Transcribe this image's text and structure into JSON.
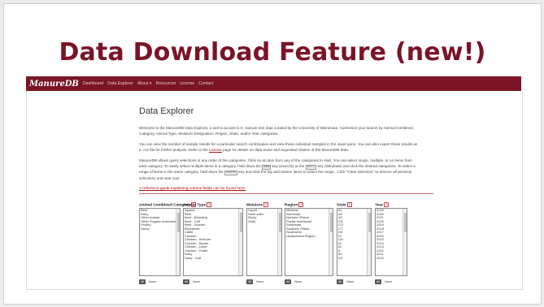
{
  "slide": {
    "title": "Data Download Feature (new!)"
  },
  "nav": {
    "brand": "ManureDB",
    "links": [
      "Dashboard",
      "Data Explorer",
      "About ▾",
      "Resources",
      "License",
      "Contact"
    ]
  },
  "page": {
    "heading": "Data Explorer",
    "para1": "Welcome to the ManureDB Data Explorer, a tool to access U.S. manure test data curated by the University of Minnesota. Customize your search by Animal Combined Category, Animal Type, Moisture Designation, Region, State, and/or Year categories.",
    "para2a": "You can view the number of sample results for a particular search combination and view those individual samples in the lower pane. You can also export those results as a .csv file for further analysis. Refer to the ",
    "para2_link": "License",
    "para2b": " page for details on data reuse and requested citation of the ManureDB data.",
    "para3a": "ManureDB allows query selections in any order of the categories. Click on an item from any of the categories to start. You can select single, multiple, or no items from each category. To easily select multiple items in a category, hold down the ",
    "key_cmd": "cmd",
    "para3b": " key (macOS) or the ",
    "key_ctrl": "ctrl",
    "para3c": " key (Windows) and click the desired categories. To select a range of items in the same category, hold down the ",
    "key_shift": "shift",
    "para3d": " key and click the top and bottom items to select the range.. Click \"Clear Selection\" to remove all previous selections and start over.",
    "reference_link": "A reference guide explaining column fields can be found here.",
    "buttons": {
      "all": "All",
      "none": "None"
    }
  },
  "filters": [
    {
      "label": "Animal Combined Category",
      "items": [
        "Beef",
        "Dairy",
        "Other Animal",
        "Other Organic Amendment",
        "Poultry",
        "Swine"
      ]
    },
    {
      "label": "Animal Type",
      "items": [
        "Alpaca",
        "Beef",
        "Beef - Breeding",
        "Beef - Calf",
        "Beef - Stocker",
        "Boxcalves",
        "Cattle",
        "Chicken",
        "Chicken - Breeder",
        "Chicken - Broiler",
        "Chicken - Layer",
        "Chicken - Pullet",
        "Dairy",
        "Dairy - Calf"
      ]
    },
    {
      "label": "Moisture",
      "items": [
        "Liquid",
        "Semi-solid",
        "Slurry",
        "Solid"
      ]
    },
    {
      "label": "Region",
      "items": [
        "Midwest",
        "Northeast",
        "Northern Plains",
        "Pacific Northwest",
        "Southeast",
        "Southern Plains",
        "Southwest",
        "Undisclosed Region"
      ]
    },
    {
      "label": "State",
      "items": [
        "AL",
        "AK",
        "AZ",
        "CA",
        "CO",
        "CT",
        "DE",
        "FL",
        "GA",
        "IA",
        "ID",
        "IL",
        "IN",
        "KS"
      ]
    },
    {
      "label": "Year",
      "items": [
        "2023",
        "2022",
        "2021",
        "2020",
        "2019",
        "2018",
        "2017",
        "2016",
        "2015",
        "2014",
        "2013",
        "2012",
        "2011",
        "2010"
      ]
    }
  ]
}
